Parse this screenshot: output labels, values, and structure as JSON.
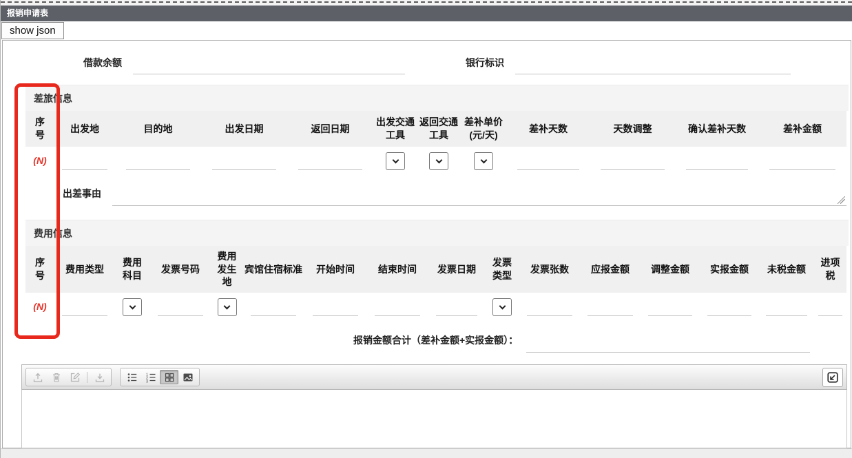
{
  "window": {
    "title": "报销申请表"
  },
  "controls": {
    "show_json": "show json"
  },
  "top_fields": {
    "loan_balance_label": "借款余额",
    "loan_balance_value": "",
    "bank_id_label": "银行标识",
    "bank_id_value": ""
  },
  "travel": {
    "section_title": "差旅信息",
    "columns": [
      "序号",
      "出发地",
      "目的地",
      "出发日期",
      "返回日期",
      "出发交通工具",
      "返回交通工具",
      "差补单价(元/天)",
      "差补天数",
      "天数调整",
      "确认差补天数",
      "差补金额"
    ],
    "cell_types": [
      "index",
      "input",
      "input",
      "input",
      "input",
      "select",
      "select",
      "select",
      "input",
      "input",
      "input",
      "input"
    ],
    "row_index": "(N)",
    "reason_label": "出差事由",
    "reason_value": ""
  },
  "expense": {
    "section_title": "费用信息",
    "columns": [
      "序号",
      "费用类型",
      "费用科目",
      "发票号码",
      "费用发生地",
      "宾馆住宿标准",
      "开始时间",
      "结束时间",
      "发票日期",
      "发票类型",
      "发票张数",
      "应报金额",
      "调整金额",
      "实报金额",
      "未税金额",
      "进项税"
    ],
    "cell_types": [
      "index",
      "input",
      "select",
      "input",
      "select",
      "input",
      "input",
      "input",
      "input",
      "select",
      "input",
      "input",
      "input",
      "input",
      "input",
      "input"
    ],
    "row_index": "(N)"
  },
  "total": {
    "label": "报销金额合计（差补金额+实报金额）：",
    "value": ""
  },
  "toolbar": {
    "file_group": [
      {
        "icon": "upload-icon",
        "disabled": true
      },
      {
        "icon": "trash-icon",
        "disabled": true
      },
      {
        "icon": "edit-icon",
        "disabled": true
      },
      {
        "icon": "separator"
      },
      {
        "icon": "download-icon",
        "disabled": true
      }
    ],
    "view_group": [
      {
        "icon": "bullet-list-icon"
      },
      {
        "icon": "numbered-list-icon"
      },
      {
        "icon": "grid-view-icon",
        "active": true
      },
      {
        "icon": "image-icon"
      }
    ],
    "import_icon": "import-icon"
  },
  "annotation": {
    "shape": "rectangle",
    "color": "#e8281c",
    "highlights": "序号"
  },
  "colors": {
    "title_bar": "#5d6167",
    "section_bg": "#f4f4f4",
    "header_bg": "#f0f0f0",
    "index_red": "#e8352b",
    "annotation_red": "#e8281c"
  }
}
